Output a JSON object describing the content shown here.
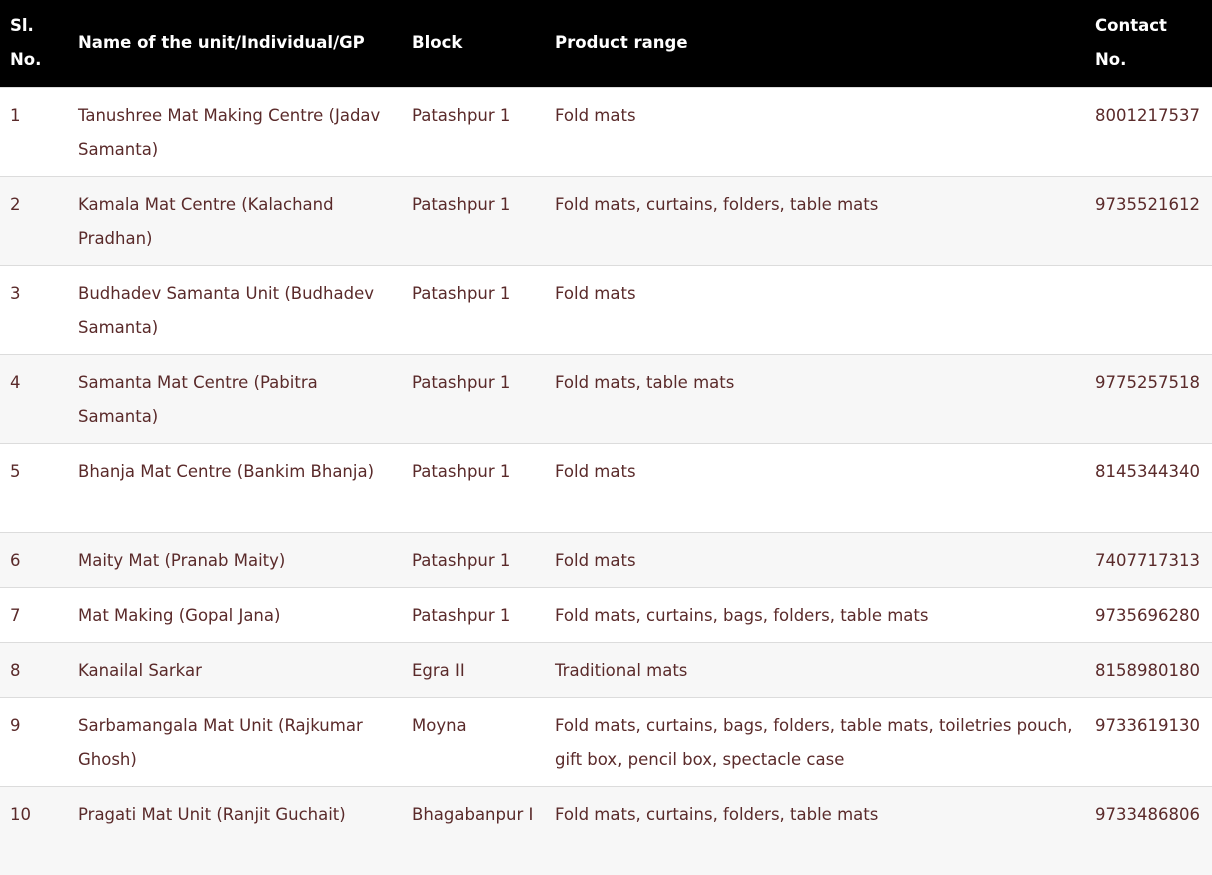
{
  "table": {
    "headers": {
      "sl_line1": "Sl.",
      "sl_line2": "No.",
      "name": "Name of the unit/Individual/GP",
      "block": "Block",
      "product": "Product range",
      "contact_line1": "Contact",
      "contact_line2": "No."
    },
    "rows": [
      {
        "sl": "1",
        "name": "Tanushree Mat Making Centre (Jadav Samanta)",
        "block": "Patashpur 1",
        "product": "Fold mats",
        "contact": "8001217537"
      },
      {
        "sl": "2",
        "name": "Kamala Mat Centre (Kalachand Pradhan)",
        "block": "Patashpur 1",
        "product": "Fold mats, curtains, folders, table mats",
        "contact": "9735521612"
      },
      {
        "sl": "3",
        "name": "Budhadev Samanta Unit (Budhadev Samanta)",
        "block": "Patashpur 1",
        "product": "Fold mats",
        "contact": ""
      },
      {
        "sl": "4",
        "name": "Samanta Mat Centre (Pabitra Samanta)",
        "block": "Patashpur 1",
        "product": "Fold mats, table mats",
        "contact": "9775257518"
      },
      {
        "sl": "5",
        "name": "Bhanja Mat Centre (Bankim Bhanja)",
        "block": "Patashpur 1",
        "product": "Fold mats",
        "contact": "8145344340"
      },
      {
        "sl": "6",
        "name": "Maity Mat (Pranab Maity)",
        "block": "Patashpur 1",
        "product": "Fold mats",
        "contact": "7407717313"
      },
      {
        "sl": "7",
        "name": "Mat Making (Gopal Jana)",
        "block": "Patashpur 1",
        "product": "Fold mats, curtains, bags, folders, table mats",
        "contact": "9735696280"
      },
      {
        "sl": "8",
        "name": "Kanailal Sarkar",
        "block": "Egra II",
        "product": "Traditional mats",
        "contact": "8158980180"
      },
      {
        "sl": "9",
        "name": "Sarbamangala Mat Unit (Rajkumar Ghosh)",
        "block": "Moyna",
        "product": "Fold mats, curtains, bags, folders, table mats, toiletries pouch, gift box, pencil box, spectacle case",
        "contact": "9733619130"
      },
      {
        "sl": "10",
        "name": "Pragati Mat Unit (Ranjit Guchait)",
        "block": "Bhagabanpur I",
        "product": "Fold mats, curtains, folders, table mats",
        "contact": "9733486806"
      }
    ]
  }
}
